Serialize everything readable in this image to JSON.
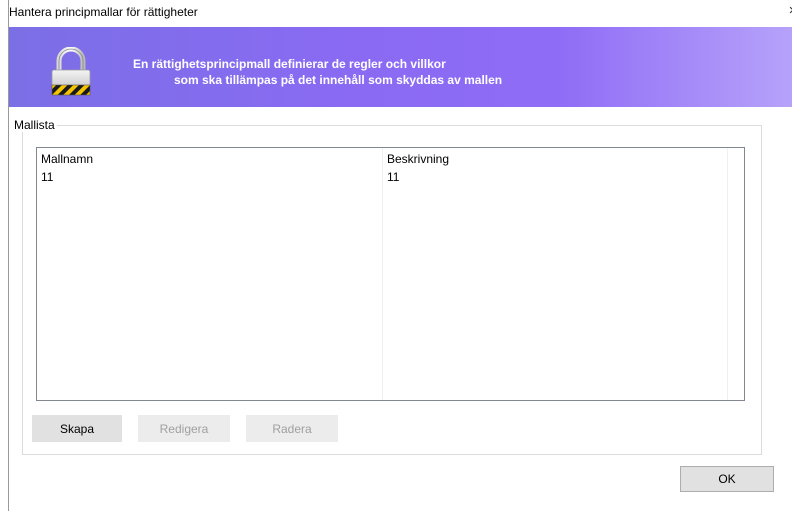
{
  "window": {
    "title": "Hantera principmallar för rättigheter",
    "close_glyph": "×"
  },
  "banner": {
    "line1": "En rättighetsprincipmall definierar de regler och villkor",
    "line2": "som ska tillämpas på det innehåll som skyddas av mallen",
    "icon": "padlock-icon",
    "gradient_colors": [
      "#7b6fe6",
      "#8f6cf6",
      "#b6a2fa"
    ]
  },
  "group": {
    "label": "Mallista"
  },
  "list": {
    "columns": [
      "Mallnamn",
      "Beskrivning"
    ],
    "rows": [
      [
        "11",
        "11"
      ]
    ]
  },
  "buttons": {
    "create": "Skapa",
    "edit": "Redigera",
    "delete": "Radera",
    "ok": "OK"
  }
}
